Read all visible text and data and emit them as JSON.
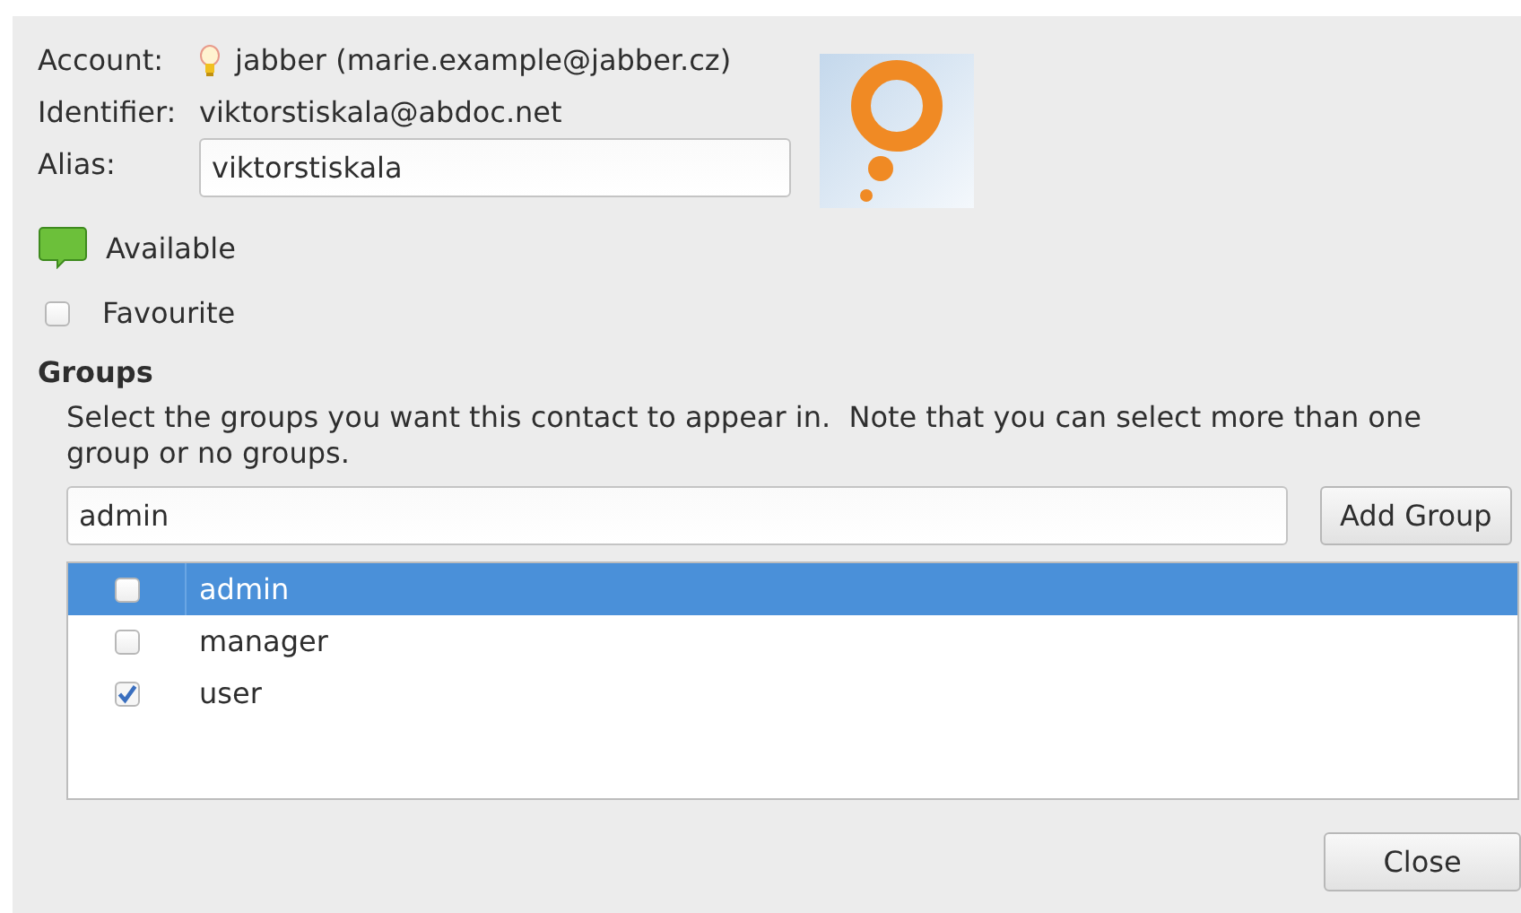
{
  "account": {
    "label": "Account:",
    "value": "jabber (marie.example@jabber.cz)"
  },
  "identifier": {
    "label": "Identifier:",
    "value": "viktorstiskala@abdoc.net"
  },
  "alias": {
    "label": "Alias:",
    "value": "viktorstiskala"
  },
  "status": {
    "kind": "available",
    "label": "Available"
  },
  "favourite": {
    "label": "Favourite",
    "checked": false
  },
  "groups": {
    "heading": "Groups",
    "description": "Select the groups you want this contact to appear in.  Note that you can select more than one group or no groups.",
    "input": {
      "value": "admin"
    },
    "add_button": "Add Group",
    "items": [
      {
        "name": "admin",
        "checked": false,
        "selected": true
      },
      {
        "name": "manager",
        "checked": false,
        "selected": false
      },
      {
        "name": "user",
        "checked": true,
        "selected": false
      }
    ]
  },
  "close_button": "Close"
}
